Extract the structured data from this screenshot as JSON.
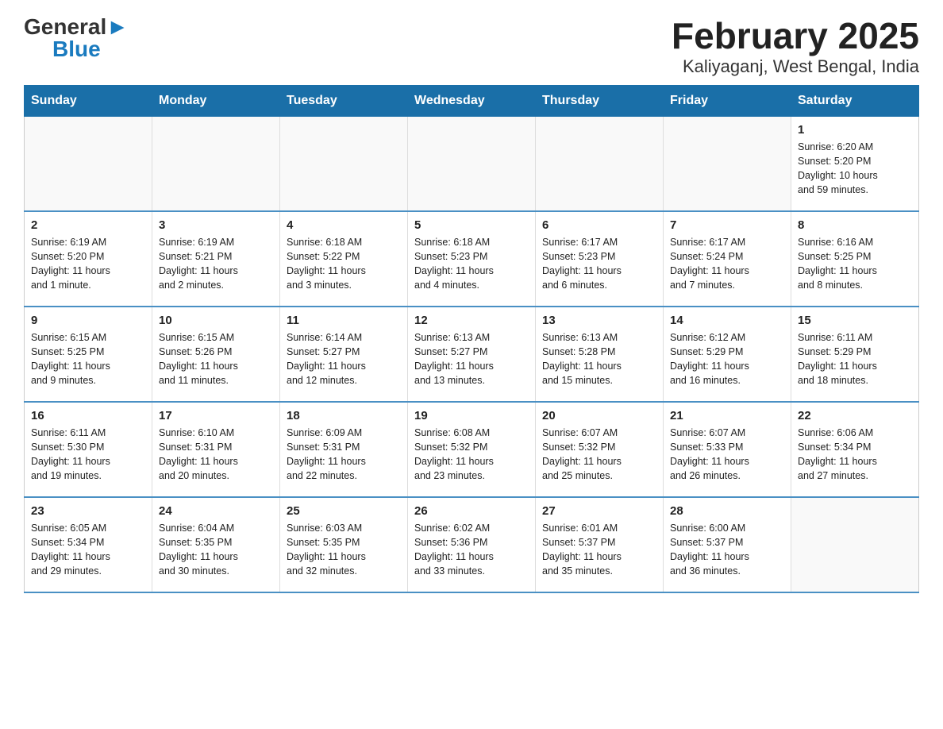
{
  "logo": {
    "general": "General",
    "blue": "Blue",
    "arrow": "▶"
  },
  "title": "February 2025",
  "subtitle": "Kaliyaganj, West Bengal, India",
  "days_header": [
    "Sunday",
    "Monday",
    "Tuesday",
    "Wednesday",
    "Thursday",
    "Friday",
    "Saturday"
  ],
  "weeks": [
    [
      {
        "day": "",
        "info": ""
      },
      {
        "day": "",
        "info": ""
      },
      {
        "day": "",
        "info": ""
      },
      {
        "day": "",
        "info": ""
      },
      {
        "day": "",
        "info": ""
      },
      {
        "day": "",
        "info": ""
      },
      {
        "day": "1",
        "info": "Sunrise: 6:20 AM\nSunset: 5:20 PM\nDaylight: 10 hours\nand 59 minutes."
      }
    ],
    [
      {
        "day": "2",
        "info": "Sunrise: 6:19 AM\nSunset: 5:20 PM\nDaylight: 11 hours\nand 1 minute."
      },
      {
        "day": "3",
        "info": "Sunrise: 6:19 AM\nSunset: 5:21 PM\nDaylight: 11 hours\nand 2 minutes."
      },
      {
        "day": "4",
        "info": "Sunrise: 6:18 AM\nSunset: 5:22 PM\nDaylight: 11 hours\nand 3 minutes."
      },
      {
        "day": "5",
        "info": "Sunrise: 6:18 AM\nSunset: 5:23 PM\nDaylight: 11 hours\nand 4 minutes."
      },
      {
        "day": "6",
        "info": "Sunrise: 6:17 AM\nSunset: 5:23 PM\nDaylight: 11 hours\nand 6 minutes."
      },
      {
        "day": "7",
        "info": "Sunrise: 6:17 AM\nSunset: 5:24 PM\nDaylight: 11 hours\nand 7 minutes."
      },
      {
        "day": "8",
        "info": "Sunrise: 6:16 AM\nSunset: 5:25 PM\nDaylight: 11 hours\nand 8 minutes."
      }
    ],
    [
      {
        "day": "9",
        "info": "Sunrise: 6:15 AM\nSunset: 5:25 PM\nDaylight: 11 hours\nand 9 minutes."
      },
      {
        "day": "10",
        "info": "Sunrise: 6:15 AM\nSunset: 5:26 PM\nDaylight: 11 hours\nand 11 minutes."
      },
      {
        "day": "11",
        "info": "Sunrise: 6:14 AM\nSunset: 5:27 PM\nDaylight: 11 hours\nand 12 minutes."
      },
      {
        "day": "12",
        "info": "Sunrise: 6:13 AM\nSunset: 5:27 PM\nDaylight: 11 hours\nand 13 minutes."
      },
      {
        "day": "13",
        "info": "Sunrise: 6:13 AM\nSunset: 5:28 PM\nDaylight: 11 hours\nand 15 minutes."
      },
      {
        "day": "14",
        "info": "Sunrise: 6:12 AM\nSunset: 5:29 PM\nDaylight: 11 hours\nand 16 minutes."
      },
      {
        "day": "15",
        "info": "Sunrise: 6:11 AM\nSunset: 5:29 PM\nDaylight: 11 hours\nand 18 minutes."
      }
    ],
    [
      {
        "day": "16",
        "info": "Sunrise: 6:11 AM\nSunset: 5:30 PM\nDaylight: 11 hours\nand 19 minutes."
      },
      {
        "day": "17",
        "info": "Sunrise: 6:10 AM\nSunset: 5:31 PM\nDaylight: 11 hours\nand 20 minutes."
      },
      {
        "day": "18",
        "info": "Sunrise: 6:09 AM\nSunset: 5:31 PM\nDaylight: 11 hours\nand 22 minutes."
      },
      {
        "day": "19",
        "info": "Sunrise: 6:08 AM\nSunset: 5:32 PM\nDaylight: 11 hours\nand 23 minutes."
      },
      {
        "day": "20",
        "info": "Sunrise: 6:07 AM\nSunset: 5:32 PM\nDaylight: 11 hours\nand 25 minutes."
      },
      {
        "day": "21",
        "info": "Sunrise: 6:07 AM\nSunset: 5:33 PM\nDaylight: 11 hours\nand 26 minutes."
      },
      {
        "day": "22",
        "info": "Sunrise: 6:06 AM\nSunset: 5:34 PM\nDaylight: 11 hours\nand 27 minutes."
      }
    ],
    [
      {
        "day": "23",
        "info": "Sunrise: 6:05 AM\nSunset: 5:34 PM\nDaylight: 11 hours\nand 29 minutes."
      },
      {
        "day": "24",
        "info": "Sunrise: 6:04 AM\nSunset: 5:35 PM\nDaylight: 11 hours\nand 30 minutes."
      },
      {
        "day": "25",
        "info": "Sunrise: 6:03 AM\nSunset: 5:35 PM\nDaylight: 11 hours\nand 32 minutes."
      },
      {
        "day": "26",
        "info": "Sunrise: 6:02 AM\nSunset: 5:36 PM\nDaylight: 11 hours\nand 33 minutes."
      },
      {
        "day": "27",
        "info": "Sunrise: 6:01 AM\nSunset: 5:37 PM\nDaylight: 11 hours\nand 35 minutes."
      },
      {
        "day": "28",
        "info": "Sunrise: 6:00 AM\nSunset: 5:37 PM\nDaylight: 11 hours\nand 36 minutes."
      },
      {
        "day": "",
        "info": ""
      }
    ]
  ]
}
